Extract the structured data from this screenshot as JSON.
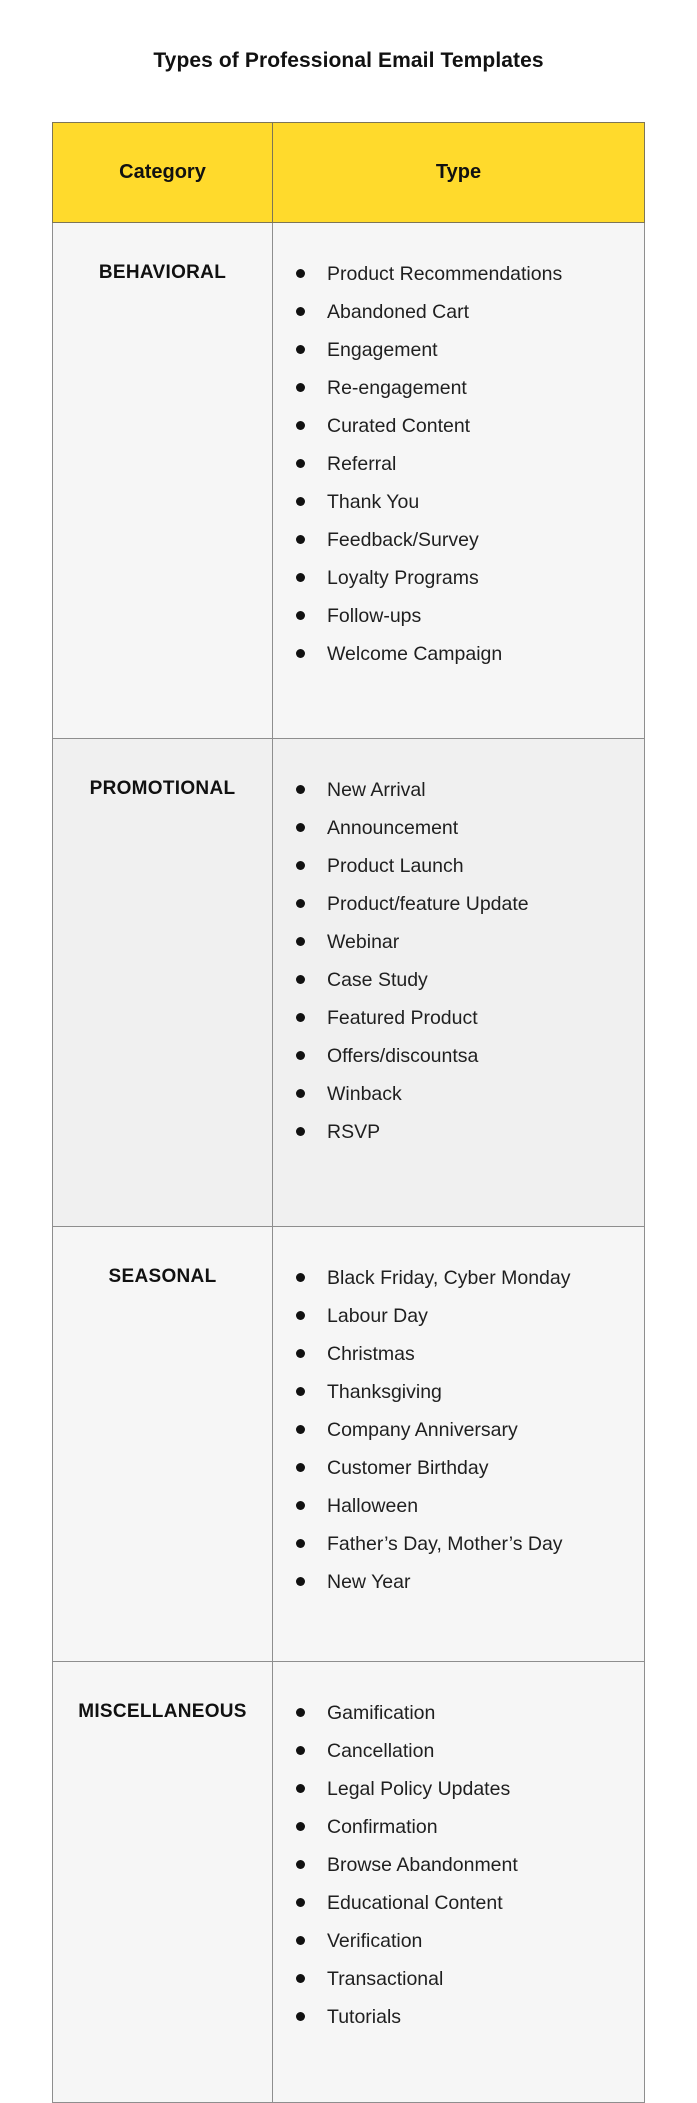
{
  "title": "Types of Professional Email Templates",
  "header": {
    "category": "Category",
    "type": "Type",
    "background_color": "#FFDA2C"
  },
  "rows": [
    {
      "category": "BEHAVIORAL",
      "types": [
        "Product Recommendations",
        "Abandoned Cart",
        "Engagement",
        "Re-engagement",
        "Curated Content",
        "Referral",
        "Thank You",
        "Feedback/Survey",
        "Loyalty Programs",
        "Follow-ups",
        "Welcome Campaign"
      ]
    },
    {
      "category": "PROMOTIONAL",
      "types": [
        "New Arrival",
        "Announcement",
        "Product Launch",
        "Product/feature Update",
        "Webinar",
        "Case Study",
        "Featured Product",
        "Offers/discountsa",
        "Winback",
        "RSVP"
      ]
    },
    {
      "category": "SEASONAL",
      "types": [
        "Black Friday, Cyber Monday",
        "Labour Day",
        "Christmas",
        "Thanksgiving",
        "Company Anniversary",
        "Customer Birthday",
        "Halloween",
        "Father’s Day, Mother’s Day",
        "New Year"
      ]
    },
    {
      "category": "MISCELLANEOUS",
      "types": [
        "Gamification",
        "Cancellation",
        "Legal Policy Updates",
        "Confirmation",
        "Browse Abandonment",
        "Educational Content",
        "Verification",
        "Transactional",
        "Tutorials"
      ]
    }
  ]
}
